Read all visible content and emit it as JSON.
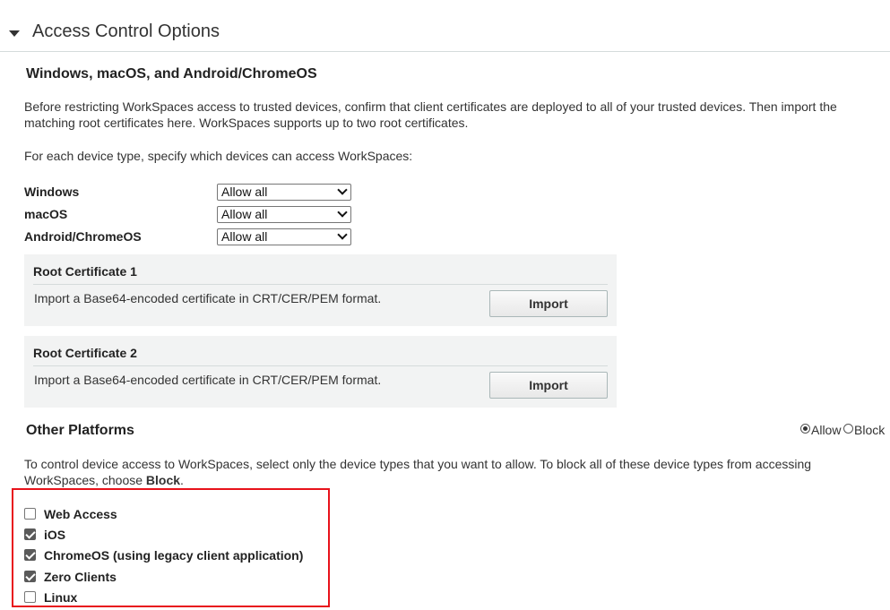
{
  "section": {
    "title": "Access Control Options"
  },
  "trusted": {
    "title": "Windows, macOS, and Android/ChromeOS",
    "intro": "Before restricting WorkSpaces access to trusted devices, confirm that client certificates are deployed to all of your trusted devices. Then import the matching root certificates here. WorkSpaces supports up to two root certificates.",
    "instruction": "For each device type, specify which devices can access WorkSpaces:",
    "devices": [
      {
        "label": "Windows",
        "value": "Allow all"
      },
      {
        "label": "macOS",
        "value": "Allow all"
      },
      {
        "label": "Android/ChromeOS",
        "value": "Allow all"
      }
    ],
    "certificates": [
      {
        "title": "Root Certificate 1",
        "description": "Import a Base64-encoded certificate in CRT/CER/PEM format.",
        "button": "Import"
      },
      {
        "title": "Root Certificate 2",
        "description": "Import a Base64-encoded certificate in CRT/CER/PEM format.",
        "button": "Import"
      }
    ]
  },
  "other": {
    "title": "Other Platforms",
    "radio": {
      "allow": "Allow",
      "block": "Block",
      "selected": "Allow"
    },
    "desc_prefix": "To control device access to WorkSpaces, select only the device types that you want to allow. To block all of these device types from accessing WorkSpaces, choose ",
    "desc_bold": "Block",
    "desc_suffix": ".",
    "platforms": [
      {
        "label": "Web Access",
        "checked": false
      },
      {
        "label": "iOS",
        "checked": true
      },
      {
        "label": "ChromeOS (using legacy client application)",
        "checked": true
      },
      {
        "label": "Zero Clients",
        "checked": true
      },
      {
        "label": "Linux",
        "checked": false
      }
    ]
  },
  "colors": {
    "highlight": "#e8121b",
    "panel": "#f2f3f3",
    "divider": "#d5dbdb"
  }
}
